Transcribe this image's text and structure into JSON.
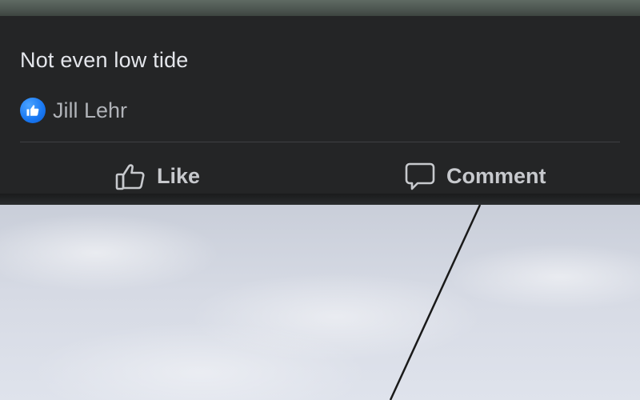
{
  "post": {
    "caption": "Not even low tide",
    "reactions": {
      "icon": "like-icon",
      "name": "Jill Lehr"
    }
  },
  "actions": {
    "like_label": "Like",
    "comment_label": "Comment"
  },
  "colors": {
    "card_background": "#242526",
    "primary_text": "#e4e6eb",
    "secondary_text": "#b0b3b8",
    "like_blue": "#1877f2"
  }
}
